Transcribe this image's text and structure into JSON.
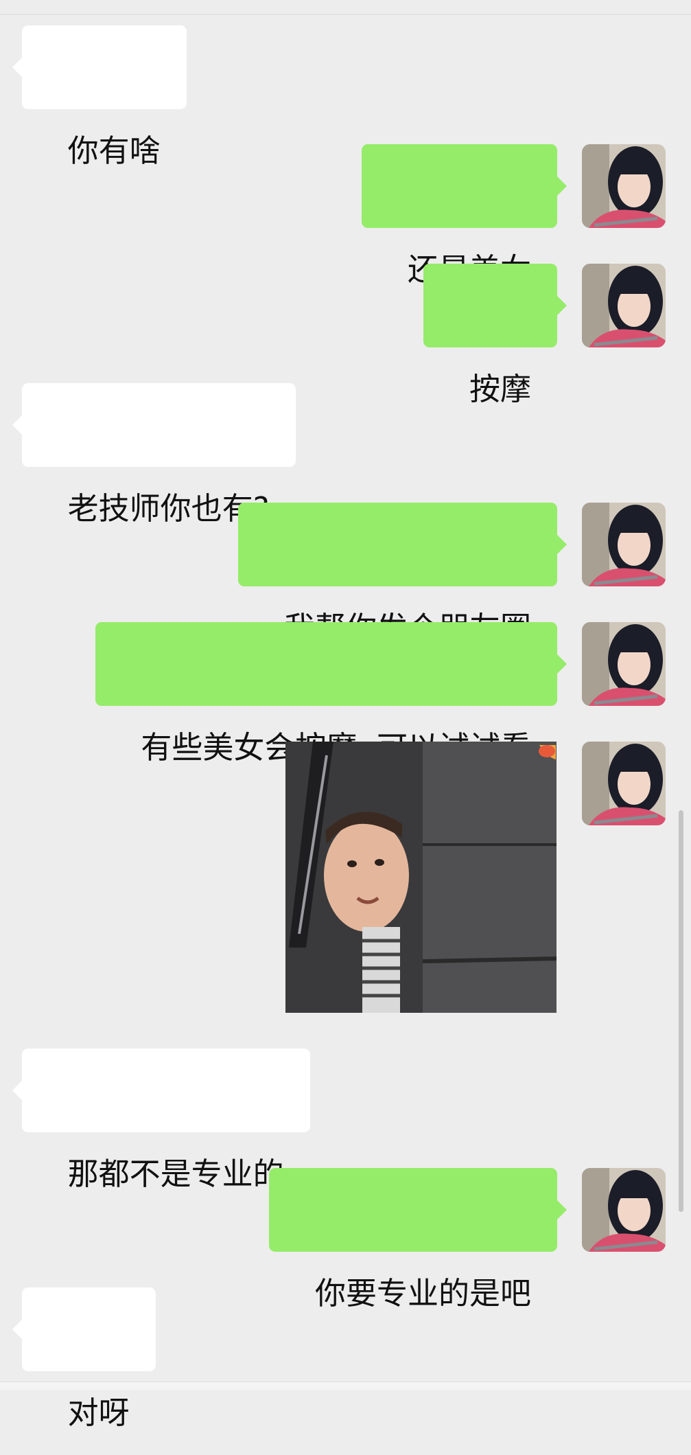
{
  "messages": [
    {
      "side": "in",
      "text": "你有啥"
    },
    {
      "side": "out",
      "text": "还是美女"
    },
    {
      "side": "out",
      "text": "按摩"
    },
    {
      "side": "in",
      "text": "老技师你也有?"
    },
    {
      "side": "out",
      "text": "我帮你发个朋友圈"
    },
    {
      "side": "out",
      "text": "有些美女会按摩  可以试试看"
    },
    {
      "side": "out",
      "type": "sticker",
      "icon": "baby-peeking-sticker"
    },
    {
      "side": "in",
      "text": "那都不是专业的"
    },
    {
      "side": "out",
      "text": "你要专业的是吧"
    },
    {
      "side": "in",
      "text": "对呀"
    }
  ],
  "colors": {
    "background": "#ededed",
    "incoming_bubble": "#ffffff",
    "outgoing_bubble": "#95ec69"
  }
}
